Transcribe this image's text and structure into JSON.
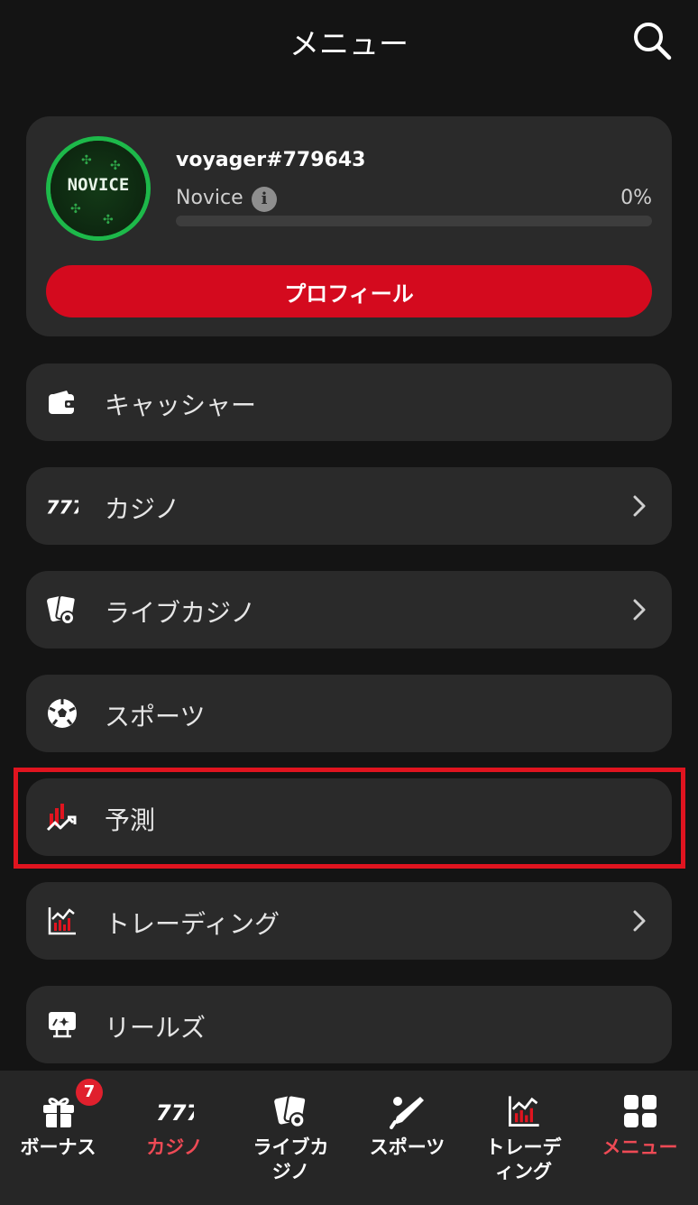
{
  "header": {
    "title": "メニュー",
    "search_icon": "search-icon"
  },
  "profile": {
    "avatar_text": "NOVICE",
    "username": "voyager#779643",
    "level": "Novice",
    "info_icon_glyph": "i",
    "progress_text": "0%",
    "progress_fraction": 0,
    "button_label": "プロフィール"
  },
  "menu": {
    "items": [
      {
        "label": "キャッシャー",
        "icon": "wallet-icon",
        "has_chevron": false
      },
      {
        "label": "カジノ",
        "icon": "slots-777-icon",
        "has_chevron": true
      },
      {
        "label": "ライブカジノ",
        "icon": "playing-cards-icon",
        "has_chevron": true
      },
      {
        "label": "スポーツ",
        "icon": "soccer-ball-icon",
        "has_chevron": false
      },
      {
        "label": "予測",
        "icon": "prediction-chart-icon",
        "has_chevron": false,
        "highlighted": true
      },
      {
        "label": "トレーディング",
        "icon": "trading-chart-icon",
        "has_chevron": true
      },
      {
        "label": "リールズ",
        "icon": "reels-screen-icon",
        "has_chevron": false
      }
    ]
  },
  "bottom_nav": {
    "items": [
      {
        "label": "ボーナス",
        "icon": "gift-icon",
        "badge": "7",
        "active": false
      },
      {
        "label": "カジノ",
        "icon": "slots-777-icon",
        "active": true
      },
      {
        "label_lines": [
          "ライブカ",
          "ジノ"
        ],
        "icon": "playing-cards-icon",
        "active": false
      },
      {
        "label": "スポーツ",
        "icon": "cricket-bat-icon",
        "active": false
      },
      {
        "label_lines": [
          "トレーデ",
          "ィング"
        ],
        "icon": "trading-chart-icon",
        "active": false
      },
      {
        "label": "メニュー",
        "icon": "grid-menu-icon",
        "active": true
      }
    ]
  },
  "colors": {
    "background": "#141414",
    "card": "#2a2a2a",
    "accent_red": "#d40a1e",
    "active_nav": "#ee4a55",
    "highlight_border": "#e0141f",
    "avatar_green": "#1db94a"
  }
}
